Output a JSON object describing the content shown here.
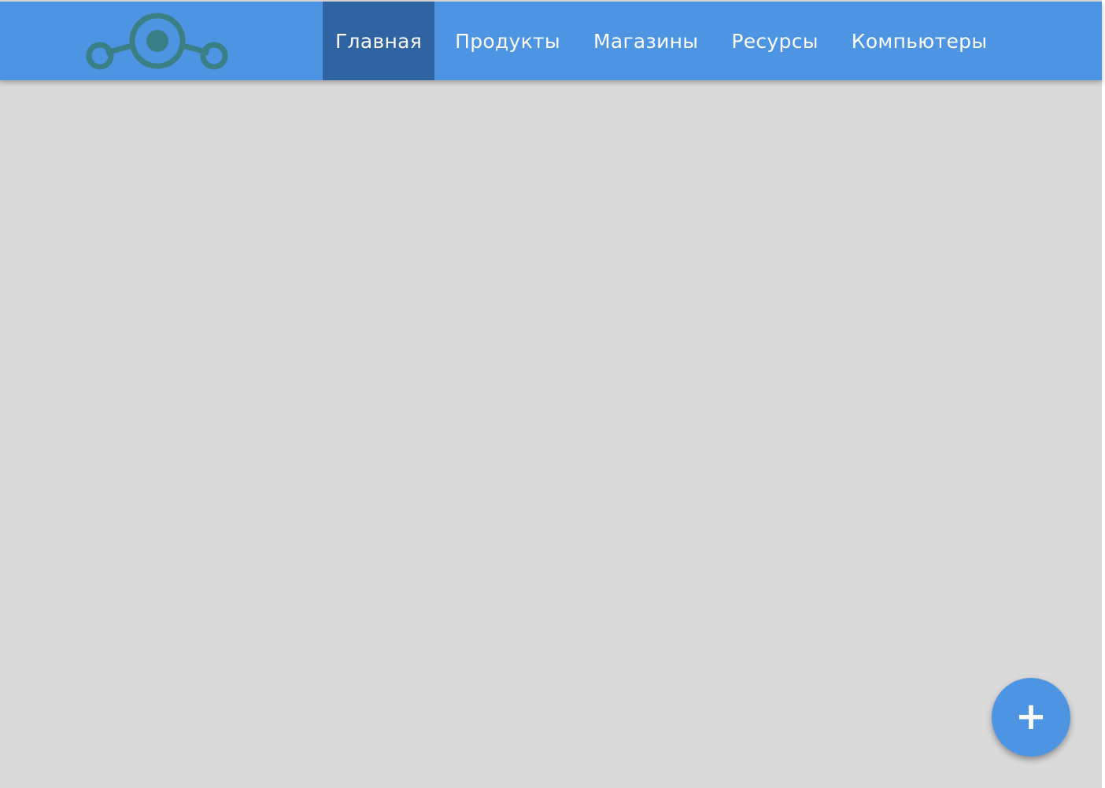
{
  "colors": {
    "header_bg": "#4d94e2",
    "nav_active_bg": "#3063a1",
    "logo_color": "#3b7f86",
    "page_bg": "#dadada",
    "fab_bg": "#4d94e2",
    "text_on_header": "#ffffff"
  },
  "header": {
    "logo_icon": "lineage-logo-icon",
    "nav": {
      "active_index": 0,
      "items": [
        {
          "label": "Главная"
        },
        {
          "label": "Продукты"
        },
        {
          "label": "Магазины"
        },
        {
          "label": "Ресурсы"
        },
        {
          "label": "Компьютеры"
        }
      ]
    }
  },
  "fab": {
    "icon": "plus-icon",
    "symbol": "+"
  }
}
